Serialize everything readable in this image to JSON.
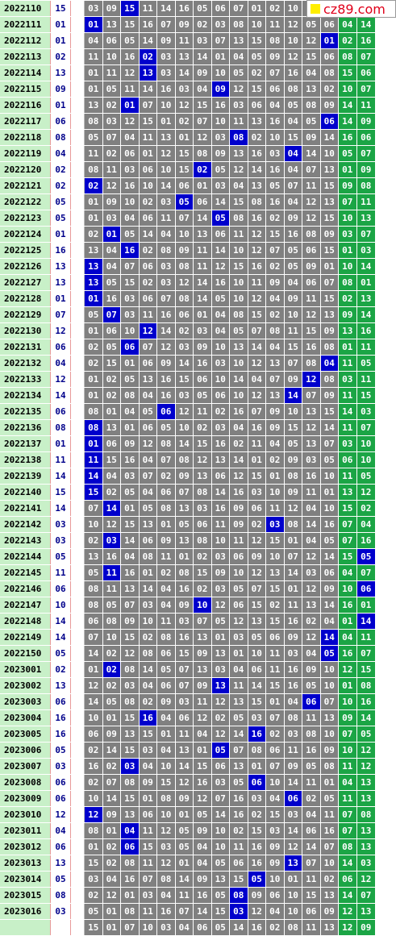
{
  "header": {
    "issue": "2022110",
    "trial": "15",
    "numbers": [
      "03",
      "09",
      "15",
      "11",
      "14",
      "16",
      "05",
      "06",
      "07",
      "01",
      "02",
      "10",
      "",
      "",
      ""
    ],
    "hit": 2
  },
  "logo": {
    "text": "cz89.com",
    "icon": "yellow-square-icon"
  },
  "rows": [
    {
      "issue": "2022111",
      "trial": "01",
      "numbers": [
        "01",
        "13",
        "15",
        "16",
        "07",
        "09",
        "02",
        "03",
        "08",
        "10",
        "11",
        "12",
        "05",
        "06",
        "04",
        "14"
      ],
      "hit": 0
    },
    {
      "issue": "2022112",
      "trial": "01",
      "numbers": [
        "04",
        "06",
        "05",
        "14",
        "09",
        "11",
        "03",
        "07",
        "13",
        "15",
        "08",
        "10",
        "12",
        "01",
        "02",
        "16"
      ],
      "hit": 13
    },
    {
      "issue": "2022113",
      "trial": "02",
      "numbers": [
        "11",
        "10",
        "16",
        "02",
        "03",
        "13",
        "14",
        "01",
        "04",
        "05",
        "09",
        "12",
        "15",
        "06",
        "08",
        "07"
      ],
      "hit": 3
    },
    {
      "issue": "2022114",
      "trial": "13",
      "numbers": [
        "01",
        "11",
        "12",
        "13",
        "03",
        "14",
        "09",
        "10",
        "05",
        "02",
        "07",
        "16",
        "04",
        "08",
        "15",
        "06"
      ],
      "hit": 3
    },
    {
      "issue": "2022115",
      "trial": "09",
      "numbers": [
        "01",
        "05",
        "11",
        "14",
        "16",
        "03",
        "04",
        "09",
        "12",
        "15",
        "06",
        "08",
        "13",
        "02",
        "10",
        "07"
      ],
      "hit": 7
    },
    {
      "issue": "2022116",
      "trial": "01",
      "numbers": [
        "13",
        "02",
        "01",
        "07",
        "10",
        "12",
        "15",
        "16",
        "03",
        "06",
        "04",
        "05",
        "08",
        "09",
        "14",
        "11"
      ],
      "hit": 2
    },
    {
      "issue": "2022117",
      "trial": "06",
      "numbers": [
        "08",
        "03",
        "12",
        "15",
        "01",
        "02",
        "07",
        "10",
        "11",
        "13",
        "16",
        "04",
        "05",
        "06",
        "14",
        "09"
      ],
      "hit": 13
    },
    {
      "issue": "2022118",
      "trial": "08",
      "numbers": [
        "05",
        "07",
        "04",
        "11",
        "13",
        "01",
        "12",
        "03",
        "08",
        "02",
        "10",
        "15",
        "09",
        "14",
        "16",
        "06"
      ],
      "hit": 8
    },
    {
      "issue": "2022119",
      "trial": "04",
      "numbers": [
        "11",
        "02",
        "06",
        "01",
        "12",
        "15",
        "08",
        "09",
        "13",
        "16",
        "03",
        "04",
        "14",
        "10",
        "05",
        "07"
      ],
      "hit": 11
    },
    {
      "issue": "2022120",
      "trial": "02",
      "numbers": [
        "08",
        "11",
        "03",
        "06",
        "10",
        "15",
        "02",
        "05",
        "12",
        "14",
        "16",
        "04",
        "07",
        "13",
        "01",
        "09"
      ],
      "hit": 6
    },
    {
      "issue": "2022121",
      "trial": "02",
      "numbers": [
        "02",
        "12",
        "16",
        "10",
        "14",
        "06",
        "01",
        "03",
        "04",
        "13",
        "05",
        "07",
        "11",
        "15",
        "09",
        "08"
      ],
      "hit": 0
    },
    {
      "issue": "2022122",
      "trial": "05",
      "numbers": [
        "01",
        "09",
        "10",
        "02",
        "03",
        "05",
        "06",
        "14",
        "15",
        "08",
        "16",
        "04",
        "12",
        "13",
        "07",
        "11"
      ],
      "hit": 5
    },
    {
      "issue": "2022123",
      "trial": "05",
      "numbers": [
        "01",
        "03",
        "04",
        "06",
        "11",
        "07",
        "14",
        "05",
        "08",
        "16",
        "02",
        "09",
        "12",
        "15",
        "10",
        "13"
      ],
      "hit": 7
    },
    {
      "issue": "2022124",
      "trial": "01",
      "numbers": [
        "02",
        "01",
        "05",
        "14",
        "04",
        "10",
        "13",
        "06",
        "11",
        "12",
        "15",
        "16",
        "08",
        "09",
        "03",
        "07"
      ],
      "hit": 1
    },
    {
      "issue": "2022125",
      "trial": "16",
      "numbers": [
        "13",
        "04",
        "16",
        "02",
        "08",
        "09",
        "11",
        "14",
        "10",
        "12",
        "07",
        "05",
        "06",
        "15",
        "01",
        "03"
      ],
      "hit": 2
    },
    {
      "issue": "2022126",
      "trial": "13",
      "numbers": [
        "13",
        "04",
        "07",
        "06",
        "03",
        "08",
        "11",
        "12",
        "15",
        "16",
        "02",
        "05",
        "09",
        "01",
        "10",
        "14"
      ],
      "hit": 0
    },
    {
      "issue": "2022127",
      "trial": "13",
      "numbers": [
        "13",
        "05",
        "15",
        "02",
        "03",
        "12",
        "14",
        "16",
        "10",
        "11",
        "09",
        "04",
        "06",
        "07",
        "08",
        "01"
      ],
      "hit": 0
    },
    {
      "issue": "2022128",
      "trial": "01",
      "numbers": [
        "01",
        "16",
        "03",
        "06",
        "07",
        "08",
        "14",
        "05",
        "10",
        "12",
        "04",
        "09",
        "11",
        "15",
        "02",
        "13"
      ],
      "hit": 0
    },
    {
      "issue": "2022129",
      "trial": "07",
      "numbers": [
        "05",
        "07",
        "03",
        "11",
        "16",
        "06",
        "01",
        "04",
        "08",
        "15",
        "02",
        "10",
        "12",
        "13",
        "09",
        "14"
      ],
      "hit": 1
    },
    {
      "issue": "2022130",
      "trial": "12",
      "numbers": [
        "01",
        "06",
        "10",
        "12",
        "14",
        "02",
        "03",
        "04",
        "05",
        "07",
        "08",
        "11",
        "15",
        "09",
        "13",
        "16"
      ],
      "hit": 3
    },
    {
      "issue": "2022131",
      "trial": "06",
      "numbers": [
        "02",
        "05",
        "06",
        "07",
        "12",
        "03",
        "09",
        "10",
        "13",
        "14",
        "04",
        "15",
        "16",
        "08",
        "01",
        "11"
      ],
      "hit": 2
    },
    {
      "issue": "2022132",
      "trial": "04",
      "numbers": [
        "02",
        "15",
        "01",
        "06",
        "09",
        "14",
        "16",
        "03",
        "10",
        "12",
        "13",
        "07",
        "08",
        "04",
        "11",
        "05"
      ],
      "hit": 13
    },
    {
      "issue": "2022133",
      "trial": "12",
      "numbers": [
        "01",
        "02",
        "05",
        "13",
        "16",
        "15",
        "06",
        "10",
        "14",
        "04",
        "07",
        "09",
        "12",
        "08",
        "03",
        "11"
      ],
      "hit": 12
    },
    {
      "issue": "2022134",
      "trial": "14",
      "numbers": [
        "01",
        "02",
        "08",
        "04",
        "16",
        "03",
        "05",
        "06",
        "10",
        "12",
        "13",
        "14",
        "07",
        "09",
        "11",
        "15"
      ],
      "hit": 11
    },
    {
      "issue": "2022135",
      "trial": "06",
      "numbers": [
        "08",
        "01",
        "04",
        "05",
        "06",
        "12",
        "11",
        "02",
        "16",
        "07",
        "09",
        "10",
        "13",
        "15",
        "14",
        "03"
      ],
      "hit": 4
    },
    {
      "issue": "2022136",
      "trial": "08",
      "numbers": [
        "08",
        "13",
        "01",
        "06",
        "05",
        "10",
        "02",
        "03",
        "04",
        "16",
        "09",
        "15",
        "12",
        "14",
        "11",
        "07"
      ],
      "hit": 0
    },
    {
      "issue": "2022137",
      "trial": "01",
      "numbers": [
        "01",
        "06",
        "09",
        "12",
        "08",
        "14",
        "15",
        "16",
        "02",
        "11",
        "04",
        "05",
        "13",
        "07",
        "03",
        "10"
      ],
      "hit": 0
    },
    {
      "issue": "2022138",
      "trial": "11",
      "numbers": [
        "11",
        "15",
        "16",
        "04",
        "07",
        "08",
        "12",
        "13",
        "14",
        "01",
        "02",
        "09",
        "03",
        "05",
        "06",
        "10"
      ],
      "hit": 0
    },
    {
      "issue": "2022139",
      "trial": "14",
      "numbers": [
        "14",
        "04",
        "03",
        "07",
        "02",
        "09",
        "13",
        "06",
        "12",
        "15",
        "01",
        "08",
        "16",
        "10",
        "11",
        "05"
      ],
      "hit": 0
    },
    {
      "issue": "2022140",
      "trial": "15",
      "numbers": [
        "15",
        "02",
        "05",
        "04",
        "06",
        "07",
        "08",
        "14",
        "16",
        "03",
        "10",
        "09",
        "11",
        "01",
        "13",
        "12"
      ],
      "hit": 0
    },
    {
      "issue": "2022141",
      "trial": "14",
      "numbers": [
        "07",
        "14",
        "01",
        "05",
        "08",
        "13",
        "03",
        "16",
        "09",
        "06",
        "11",
        "12",
        "04",
        "10",
        "15",
        "02"
      ],
      "hit": 1
    },
    {
      "issue": "2022142",
      "trial": "03",
      "numbers": [
        "10",
        "12",
        "15",
        "13",
        "01",
        "05",
        "06",
        "11",
        "09",
        "02",
        "03",
        "08",
        "14",
        "16",
        "07",
        "04"
      ],
      "hit": 10
    },
    {
      "issue": "2022143",
      "trial": "03",
      "numbers": [
        "02",
        "03",
        "14",
        "06",
        "09",
        "13",
        "08",
        "10",
        "11",
        "12",
        "15",
        "01",
        "04",
        "05",
        "07",
        "16"
      ],
      "hit": 1
    },
    {
      "issue": "2022144",
      "trial": "05",
      "numbers": [
        "13",
        "16",
        "04",
        "08",
        "11",
        "01",
        "02",
        "03",
        "06",
        "09",
        "10",
        "07",
        "12",
        "14",
        "15",
        "05"
      ],
      "hit": 15
    },
    {
      "issue": "2022145",
      "trial": "11",
      "numbers": [
        "05",
        "11",
        "16",
        "01",
        "02",
        "08",
        "15",
        "09",
        "10",
        "12",
        "13",
        "14",
        "03",
        "06",
        "04",
        "07"
      ],
      "hit": 1
    },
    {
      "issue": "2022146",
      "trial": "06",
      "numbers": [
        "08",
        "11",
        "13",
        "14",
        "04",
        "16",
        "02",
        "03",
        "05",
        "07",
        "15",
        "01",
        "12",
        "09",
        "10",
        "06"
      ],
      "hit": 15
    },
    {
      "issue": "2022147",
      "trial": "10",
      "numbers": [
        "08",
        "05",
        "07",
        "03",
        "04",
        "09",
        "10",
        "12",
        "06",
        "15",
        "02",
        "11",
        "13",
        "14",
        "16",
        "01"
      ],
      "hit": 6
    },
    {
      "issue": "2022148",
      "trial": "14",
      "numbers": [
        "06",
        "08",
        "09",
        "10",
        "11",
        "03",
        "07",
        "05",
        "12",
        "13",
        "15",
        "16",
        "02",
        "04",
        "01",
        "14"
      ],
      "hit": 15
    },
    {
      "issue": "2022149",
      "trial": "14",
      "numbers": [
        "07",
        "10",
        "15",
        "02",
        "08",
        "16",
        "13",
        "01",
        "03",
        "05",
        "06",
        "09",
        "12",
        "14",
        "04",
        "11"
      ],
      "hit": 13
    },
    {
      "issue": "2022150",
      "trial": "05",
      "numbers": [
        "14",
        "02",
        "12",
        "08",
        "06",
        "15",
        "09",
        "13",
        "01",
        "10",
        "11",
        "03",
        "04",
        "05",
        "16",
        "07"
      ],
      "hit": 13
    },
    {
      "issue": "2023001",
      "trial": "02",
      "numbers": [
        "01",
        "02",
        "08",
        "14",
        "05",
        "07",
        "13",
        "03",
        "04",
        "06",
        "11",
        "16",
        "09",
        "10",
        "12",
        "15"
      ],
      "hit": 1
    },
    {
      "issue": "2023002",
      "trial": "13",
      "numbers": [
        "12",
        "02",
        "03",
        "04",
        "06",
        "07",
        "09",
        "13",
        "11",
        "14",
        "15",
        "16",
        "05",
        "10",
        "01",
        "08"
      ],
      "hit": 7
    },
    {
      "issue": "2023003",
      "trial": "06",
      "numbers": [
        "14",
        "05",
        "08",
        "02",
        "09",
        "03",
        "11",
        "12",
        "13",
        "15",
        "01",
        "04",
        "06",
        "07",
        "10",
        "16"
      ],
      "hit": 12
    },
    {
      "issue": "2023004",
      "trial": "16",
      "numbers": [
        "10",
        "01",
        "15",
        "16",
        "04",
        "06",
        "12",
        "02",
        "05",
        "03",
        "07",
        "08",
        "11",
        "13",
        "09",
        "14"
      ],
      "hit": 3
    },
    {
      "issue": "2023005",
      "trial": "16",
      "numbers": [
        "06",
        "09",
        "13",
        "15",
        "01",
        "11",
        "04",
        "12",
        "14",
        "16",
        "02",
        "03",
        "08",
        "10",
        "07",
        "05"
      ],
      "hit": 9
    },
    {
      "issue": "2023006",
      "trial": "05",
      "numbers": [
        "02",
        "14",
        "15",
        "03",
        "04",
        "13",
        "01",
        "05",
        "07",
        "08",
        "06",
        "11",
        "16",
        "09",
        "10",
        "12"
      ],
      "hit": 7
    },
    {
      "issue": "2023007",
      "trial": "03",
      "numbers": [
        "16",
        "02",
        "03",
        "04",
        "10",
        "14",
        "15",
        "06",
        "13",
        "01",
        "07",
        "09",
        "05",
        "08",
        "11",
        "12"
      ],
      "hit": 2
    },
    {
      "issue": "2023008",
      "trial": "06",
      "numbers": [
        "02",
        "07",
        "08",
        "09",
        "15",
        "12",
        "16",
        "03",
        "05",
        "06",
        "10",
        "14",
        "11",
        "01",
        "04",
        "13"
      ],
      "hit": 9
    },
    {
      "issue": "2023009",
      "trial": "06",
      "numbers": [
        "10",
        "14",
        "15",
        "01",
        "08",
        "09",
        "12",
        "07",
        "16",
        "03",
        "04",
        "06",
        "02",
        "05",
        "11",
        "13"
      ],
      "hit": 11
    },
    {
      "issue": "2023010",
      "trial": "12",
      "numbers": [
        "12",
        "09",
        "13",
        "06",
        "10",
        "01",
        "05",
        "14",
        "16",
        "02",
        "15",
        "03",
        "04",
        "11",
        "07",
        "08"
      ],
      "hit": 0
    },
    {
      "issue": "2023011",
      "trial": "04",
      "numbers": [
        "08",
        "01",
        "04",
        "11",
        "12",
        "05",
        "09",
        "10",
        "02",
        "15",
        "03",
        "14",
        "06",
        "16",
        "07",
        "13"
      ],
      "hit": 2
    },
    {
      "issue": "2023012",
      "trial": "06",
      "numbers": [
        "01",
        "02",
        "06",
        "15",
        "03",
        "05",
        "04",
        "10",
        "11",
        "16",
        "09",
        "12",
        "14",
        "07",
        "08",
        "13"
      ],
      "hit": 2
    },
    {
      "issue": "2023013",
      "trial": "13",
      "numbers": [
        "15",
        "02",
        "08",
        "11",
        "12",
        "01",
        "04",
        "05",
        "06",
        "16",
        "09",
        "13",
        "07",
        "10",
        "14",
        "03"
      ],
      "hit": 11
    },
    {
      "issue": "2023014",
      "trial": "05",
      "numbers": [
        "03",
        "04",
        "16",
        "07",
        "08",
        "14",
        "09",
        "13",
        "15",
        "05",
        "10",
        "01",
        "11",
        "02",
        "06",
        "12"
      ],
      "hit": 9
    },
    {
      "issue": "2023015",
      "trial": "08",
      "numbers": [
        "02",
        "12",
        "01",
        "03",
        "04",
        "11",
        "16",
        "05",
        "08",
        "09",
        "06",
        "10",
        "15",
        "13",
        "14",
        "07"
      ],
      "hit": 8
    },
    {
      "issue": "2023016",
      "trial": "03",
      "numbers": [
        "05",
        "01",
        "08",
        "11",
        "16",
        "07",
        "14",
        "15",
        "03",
        "12",
        "04",
        "10",
        "06",
        "09",
        "12",
        "13"
      ],
      "hit": 8
    },
    {
      "issue": "",
      "trial": "",
      "numbers": [
        "15",
        "01",
        "07",
        "10",
        "03",
        "04",
        "06",
        "05",
        "14",
        "16",
        "02",
        "08",
        "11",
        "13",
        "12",
        "09"
      ],
      "hit": -1
    }
  ]
}
